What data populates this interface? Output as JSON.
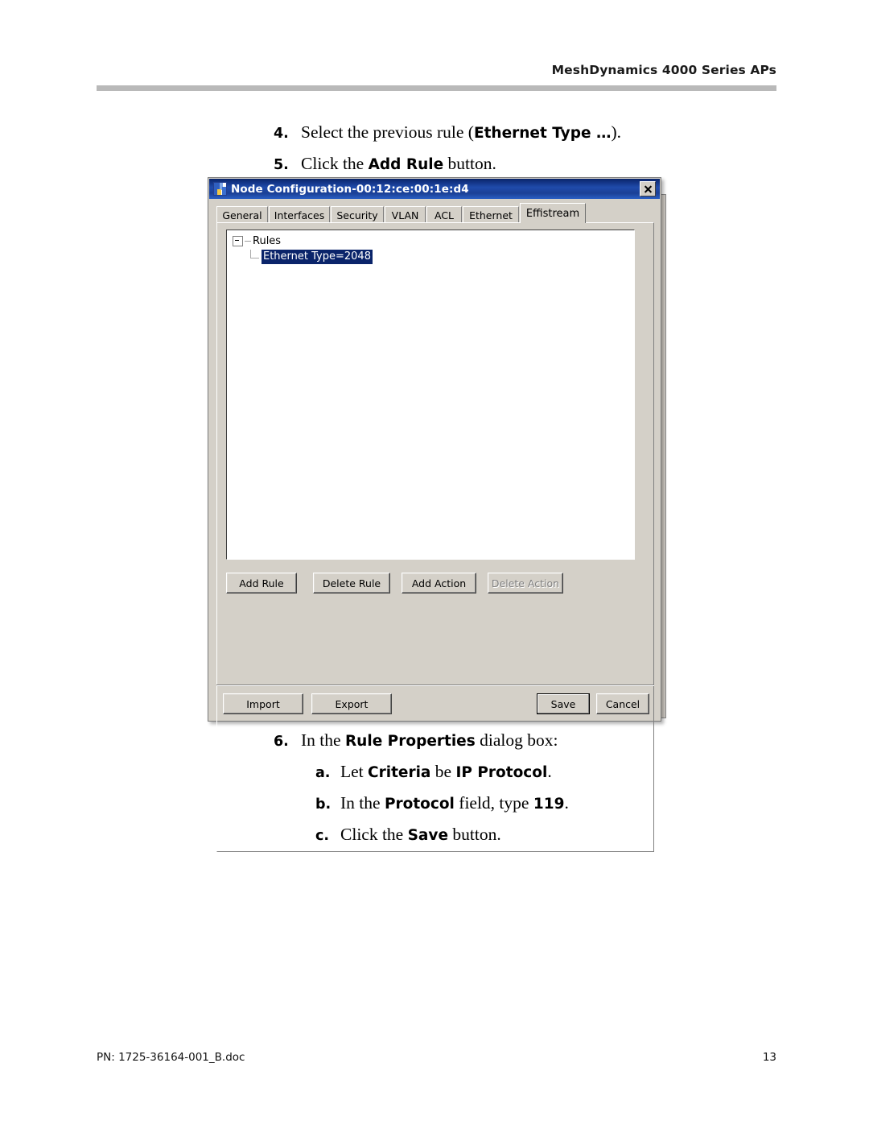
{
  "page": {
    "header_title": "MeshDynamics 4000 Series APs",
    "footer_left": "PN: 1725-36164-001_B.doc",
    "footer_page": "13"
  },
  "steps_top": [
    {
      "number": "4.",
      "parts": [
        {
          "text": "Select the previous rule (",
          "bold": false
        },
        {
          "text": "Ethernet Type …",
          "bold": true
        },
        {
          "text": ").",
          "bold": false
        }
      ]
    },
    {
      "number": "5.",
      "parts": [
        {
          "text": "Click the ",
          "bold": false
        },
        {
          "text": "Add Rule",
          "bold": true
        },
        {
          "text": " button.",
          "bold": false
        }
      ]
    }
  ],
  "steps_bottom": [
    {
      "number": "6.",
      "sub": false,
      "parts": [
        {
          "text": "In the ",
          "bold": false
        },
        {
          "text": "Rule Properties",
          "bold": true
        },
        {
          "text": " dialog box:",
          "bold": false
        }
      ]
    },
    {
      "number": "a.",
      "sub": true,
      "parts": [
        {
          "text": "Let ",
          "bold": false
        },
        {
          "text": "Criteria",
          "bold": true
        },
        {
          "text": " be ",
          "bold": false
        },
        {
          "text": "IP Protocol",
          "bold": true
        },
        {
          "text": ".",
          "bold": false
        }
      ]
    },
    {
      "number": "b.",
      "sub": true,
      "parts": [
        {
          "text": "In the ",
          "bold": false
        },
        {
          "text": "Protocol",
          "bold": true
        },
        {
          "text": " field, type ",
          "bold": false
        },
        {
          "text": "119",
          "bold": true
        },
        {
          "text": ".",
          "bold": false
        }
      ]
    },
    {
      "number": "c.",
      "sub": true,
      "parts": [
        {
          "text": "Click the ",
          "bold": false
        },
        {
          "text": "Save",
          "bold": true
        },
        {
          "text": " button.",
          "bold": false
        }
      ]
    }
  ],
  "dialog": {
    "title": "Node Configuration-00:12:ce:00:1e:d4",
    "close_label": "×",
    "colors": {
      "titlebar": "#1f4bab",
      "face": "#d4d0c8",
      "selection": "#0a246a"
    },
    "tabs": [
      {
        "label": "General",
        "active": false
      },
      {
        "label": "Interfaces",
        "active": false
      },
      {
        "label": "Security",
        "active": false
      },
      {
        "label": "VLAN",
        "active": false
      },
      {
        "label": "ACL",
        "active": false
      },
      {
        "label": "Ethernet",
        "active": false
      },
      {
        "label": "Effistream",
        "active": true
      }
    ],
    "tree": {
      "root_label": "Rules",
      "selected_child_label": "Ethernet Type=2048"
    },
    "action_buttons": [
      {
        "label": "Add Rule",
        "disabled": false
      },
      {
        "label": "Delete Rule",
        "disabled": false
      },
      {
        "label": "Add Action",
        "disabled": false
      },
      {
        "label": "Delete Action",
        "disabled": true
      }
    ],
    "footer_buttons": {
      "import": "Import",
      "export": "Export",
      "save": "Save",
      "cancel": "Cancel"
    }
  }
}
